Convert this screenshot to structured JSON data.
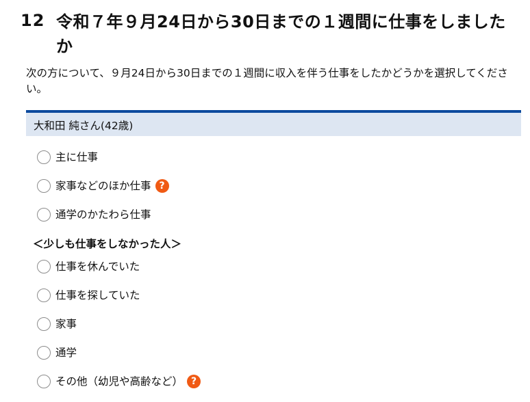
{
  "question": {
    "number": "12",
    "title": "令和７年９月24日から30日までの１週間に仕事をしましたか",
    "instruction": "次の方について、９月24日から30日までの１週間に収入を伴う仕事をしたかどうかを選択してください。"
  },
  "person": {
    "name": "大和田 純さん(42歳)"
  },
  "options_worked": [
    {
      "label": "主に仕事"
    },
    {
      "label": "家事などのほか仕事"
    },
    {
      "label": "通学のかたわら仕事"
    }
  ],
  "group_not_worked": {
    "heading": "＜少しも仕事をしなかった人＞"
  },
  "options_not_worked": [
    {
      "label": "仕事を休んでいた"
    },
    {
      "label": "仕事を探していた"
    },
    {
      "label": "家事"
    },
    {
      "label": "通学"
    },
    {
      "label": "その他（幼児や高齢など）"
    }
  ],
  "icons": {
    "help_glyph": "?",
    "help_color": "#f05a14",
    "accent_color": "#0c4a9e"
  }
}
